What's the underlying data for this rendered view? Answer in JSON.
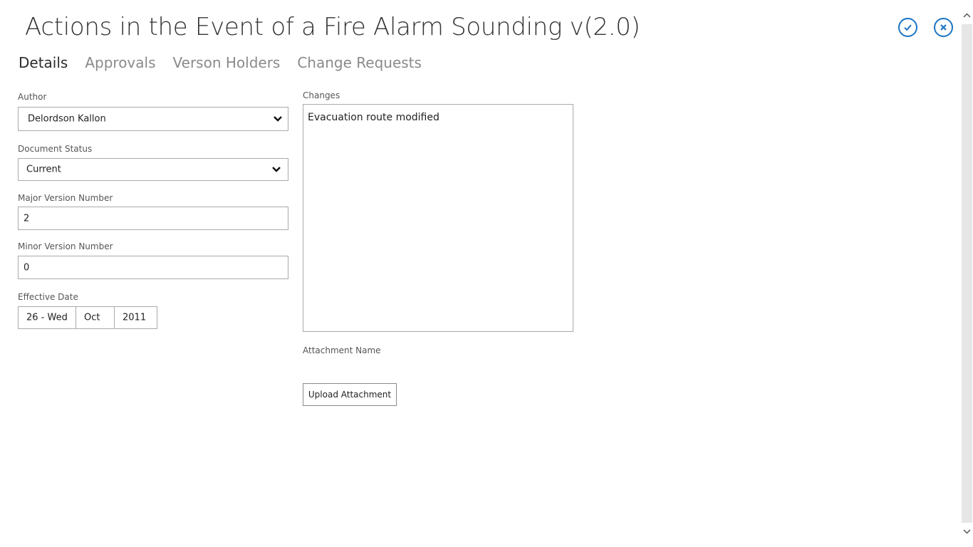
{
  "header": {
    "title": "Actions in the Event of a Fire Alarm Sounding v(2.0)",
    "confirm_icon": "check-circle-icon",
    "close_icon": "x-circle-icon",
    "accent_color": "#1b74c4"
  },
  "tabs": [
    {
      "label": "Details",
      "active": true
    },
    {
      "label": "Approvals",
      "active": false
    },
    {
      "label": "Verson Holders",
      "active": false
    },
    {
      "label": "Change Requests",
      "active": false
    }
  ],
  "form": {
    "author": {
      "label": "Author",
      "value": "Delordson Kallon"
    },
    "document_status": {
      "label": "Document Status",
      "value": "Current"
    },
    "major_version": {
      "label": "Major Version Number",
      "value": "2"
    },
    "minor_version": {
      "label": "Minor Version Number",
      "value": "0"
    },
    "effective_date": {
      "label": "Effective Date",
      "day": "26 - Wed",
      "month": "Oct",
      "year": "2011"
    },
    "changes": {
      "label": "Changes",
      "value": "Evacuation route modified"
    },
    "attachment": {
      "label": "Attachment Name",
      "upload_label": "Upload Attachment"
    }
  }
}
